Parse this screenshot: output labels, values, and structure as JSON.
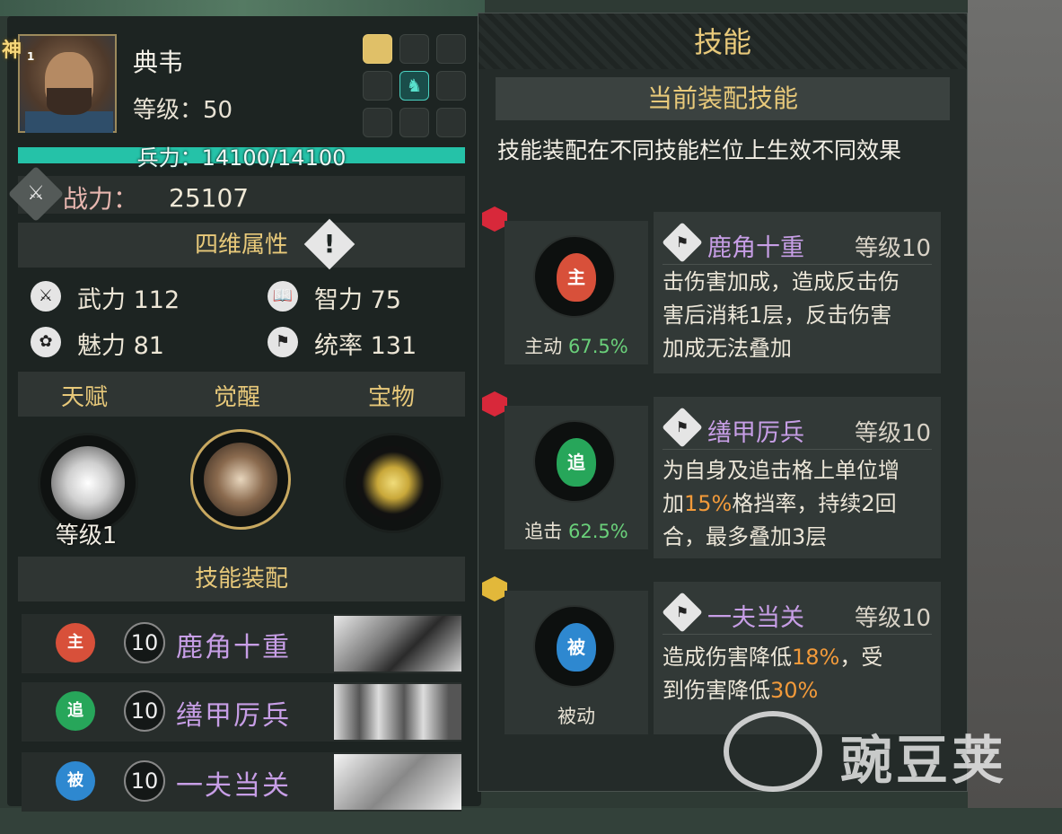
{
  "hero": {
    "badge": "神",
    "badge_num": "1",
    "name": "典韦",
    "level": "等级：50",
    "hp": "兵力：14100/14100",
    "power_label": "战力：",
    "power_value": "25107"
  },
  "attributes": {
    "header": "四维属性",
    "warn": "!",
    "items": [
      {
        "label": "武力",
        "value": "112",
        "icon": "sword-icon"
      },
      {
        "label": "智力",
        "value": "75",
        "icon": "book-icon"
      },
      {
        "label": "魅力",
        "value": "81",
        "icon": "flower-icon"
      },
      {
        "label": "统率",
        "value": "131",
        "icon": "command-icon"
      }
    ]
  },
  "tabs": {
    "talent": "天赋",
    "awaken": "觉醒",
    "treasure": "宝物",
    "talent_level": "等级1"
  },
  "loadout": {
    "header": "技能装配",
    "rows": [
      {
        "type": "主",
        "level": "10",
        "name": "鹿角十重",
        "color": "#d8503a"
      },
      {
        "type": "追",
        "level": "10",
        "name": "缮甲厉兵",
        "color": "#27a65a"
      },
      {
        "type": "被",
        "level": "10",
        "name": "一夫当关",
        "color": "#2e88d0"
      }
    ]
  },
  "panel": {
    "title": "技能",
    "current_header": "当前装配技能",
    "description": "技能装配在不同技能栏位上生效不同效果"
  },
  "skills": [
    {
      "type": "主",
      "caption": "主动",
      "pct": "67.5%",
      "name": "鹿角十重",
      "level": "等级10",
      "gem": "red",
      "color": "#d8503a",
      "desc_lines": [
        "击伤害加成，造成反击伤",
        "害后消耗1层，反击伤害",
        "加成无法叠加"
      ]
    },
    {
      "type": "追",
      "caption": "追击",
      "pct": "62.5%",
      "name": "缮甲厉兵",
      "level": "等级10",
      "gem": "red",
      "color": "#27a65a",
      "desc_lines": [
        "为自身及追击格上单位增",
        "加15%格挡率，持续2回",
        "合，最多叠加3层"
      ]
    },
    {
      "type": "被",
      "caption": "被动",
      "pct": "",
      "name": "一夫当关",
      "level": "等级10",
      "gem": "gold",
      "color": "#2e88d0",
      "desc_lines": [
        "造成伤害降低18%，受",
        "到伤害降低30%"
      ]
    }
  ],
  "watermark": "豌豆荚"
}
